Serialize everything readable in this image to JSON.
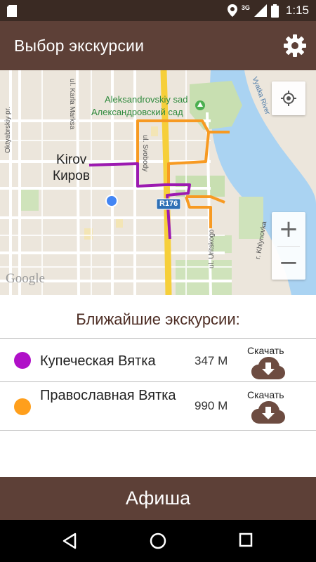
{
  "status_bar": {
    "network": "3G",
    "time": "1:15"
  },
  "app_bar": {
    "title": "Выбор экскурсии"
  },
  "map": {
    "labels": {
      "park_en": "Aleksandrovskiy sad",
      "park_ru": "Александровский сад",
      "city_en": "Kirov",
      "city_ru": "Киров",
      "road_sign": "R176",
      "street_karla_marksa": "ul. Karla Marksa",
      "street_oktyabrskiy": "Oktyabrskiy pr.",
      "street_svobody": "ul. Svobody",
      "street_uritskogo": "ul. Uritskogo",
      "river": "Vyatka River",
      "street_khlynovka": "r. Khlynovka",
      "google": "Google"
    },
    "zoom_in": "+",
    "zoom_out": "−"
  },
  "list": {
    "heading": "Ближайшие экскурсии:",
    "tours": [
      {
        "name": "Купеческая Вятка",
        "distance": "347 М",
        "download_label": "Скачать",
        "color": "#b010c8"
      },
      {
        "name": "Православная Вятка",
        "distance": "990 М",
        "download_label": "Скачать",
        "color": "#ff9f1c"
      }
    ]
  },
  "afisha": {
    "label": "Афиша"
  },
  "colors": {
    "primary": "#5d4037",
    "status": "#3a2a23",
    "route_purple": "#9c1ab1",
    "route_orange": "#f79a22",
    "river": "#aad3f2"
  }
}
